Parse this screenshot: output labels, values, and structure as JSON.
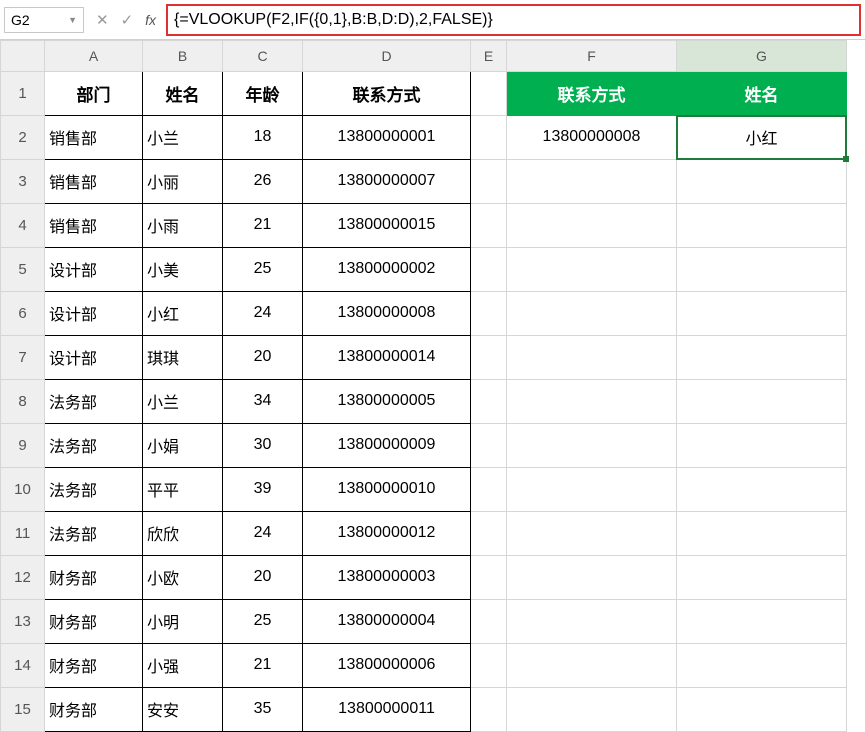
{
  "namebox": "G2",
  "formula": "{=VLOOKUP(F2,IF({0,1},B:B,D:D),2,FALSE)}",
  "columns": [
    "A",
    "B",
    "C",
    "D",
    "E",
    "F",
    "G"
  ],
  "header1": {
    "a": "部门",
    "b": "姓名",
    "c": "年龄",
    "d": "联系方式",
    "f": "联系方式",
    "g": "姓名"
  },
  "rows_label": [
    "1",
    "2",
    "3",
    "4",
    "5",
    "6",
    "7",
    "8",
    "9",
    "10",
    "11",
    "12",
    "13",
    "14",
    "15"
  ],
  "data": [
    {
      "a": "销售部",
      "b": "小兰",
      "c": "18",
      "d": "13800000001"
    },
    {
      "a": "销售部",
      "b": "小丽",
      "c": "26",
      "d": "13800000007"
    },
    {
      "a": "销售部",
      "b": "小雨",
      "c": "21",
      "d": "13800000015"
    },
    {
      "a": "设计部",
      "b": "小美",
      "c": "25",
      "d": "13800000002"
    },
    {
      "a": "设计部",
      "b": "小红",
      "c": "24",
      "d": "13800000008"
    },
    {
      "a": "设计部",
      "b": "琪琪",
      "c": "20",
      "d": "13800000014"
    },
    {
      "a": "法务部",
      "b": "小兰",
      "c": "34",
      "d": "13800000005"
    },
    {
      "a": "法务部",
      "b": "小娟",
      "c": "30",
      "d": "13800000009"
    },
    {
      "a": "法务部",
      "b": "平平",
      "c": "39",
      "d": "13800000010"
    },
    {
      "a": "法务部",
      "b": "欣欣",
      "c": "24",
      "d": "13800000012"
    },
    {
      "a": "财务部",
      "b": "小欧",
      "c": "20",
      "d": "13800000003"
    },
    {
      "a": "财务部",
      "b": "小明",
      "c": "25",
      "d": "13800000004"
    },
    {
      "a": "财务部",
      "b": "小强",
      "c": "21",
      "d": "13800000006"
    },
    {
      "a": "财务部",
      "b": "安安",
      "c": "35",
      "d": "13800000011"
    }
  ],
  "lookup": {
    "f": "13800000008",
    "g": "小红"
  }
}
